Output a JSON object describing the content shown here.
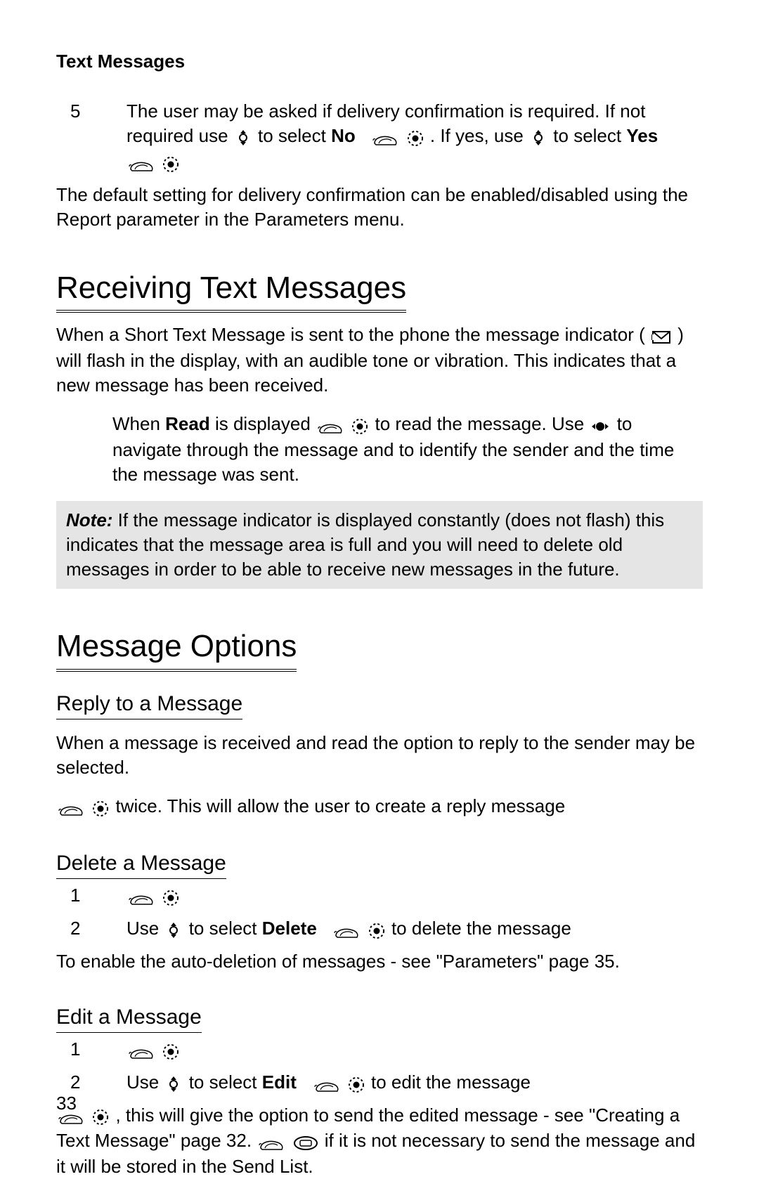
{
  "header": "Text Messages",
  "step5_num": "5",
  "step5_a": "The user may be asked if delivery confirmation is required. If not required use ",
  "step5_b": " to select ",
  "step5_no": "No",
  "step5_c": ". If yes, use ",
  "step5_d": " to select ",
  "step5_yes": "Yes",
  "default_para": "The default setting for delivery confirmation can be enabled/disabled using the Report parameter in the Parameters menu.",
  "h_receiving": "Receiving Text Messages",
  "recv_a": "When a Short Text Message is sent to the phone the message indicator (",
  "recv_b": ") will flash in the display, with an audible tone or vibration. This indicates that a new message has been received.",
  "read_a": "When ",
  "read_word": "Read",
  "read_b": " is displayed ",
  "read_c": " to read the message. Use ",
  "read_d": " to navigate through the message and to identify the sender and the time the message was sent.",
  "note_label": "Note:",
  "note_text": " If the message indicator is displayed constantly (does not flash) this indicates that the message area is full and you will need to delete old messages in order to be able to receive new messages in the future.",
  "h_options": "Message Options",
  "h_reply": "Reply to a Message",
  "reply_para": "When a message is received and read the option to reply to the sender may be selected.",
  "reply_tail": " twice. This will allow the user to create a reply message",
  "h_delete": "Delete a Message",
  "del_1": "1",
  "del_2": "2",
  "del_2a": "Use ",
  "del_2b": " to select ",
  "del_word": "Delete",
  "del_2c": " to delete the message",
  "del_auto": "To enable the auto-deletion of messages - see \"Parameters\" page 35.",
  "h_edit": "Edit a Message",
  "ed_1": "1",
  "ed_2": "2",
  "ed_2a": "Use ",
  "ed_2b": " to select ",
  "ed_word": "Edit",
  "ed_2c": " to edit the message",
  "ed_tail_a": ", this will give the option to send the edited message - see \"Creating a Text Message\" page 32. ",
  "ed_tail_b": " if it is not necessary to send the message and it will be stored in the Send List.",
  "page_number": "33"
}
